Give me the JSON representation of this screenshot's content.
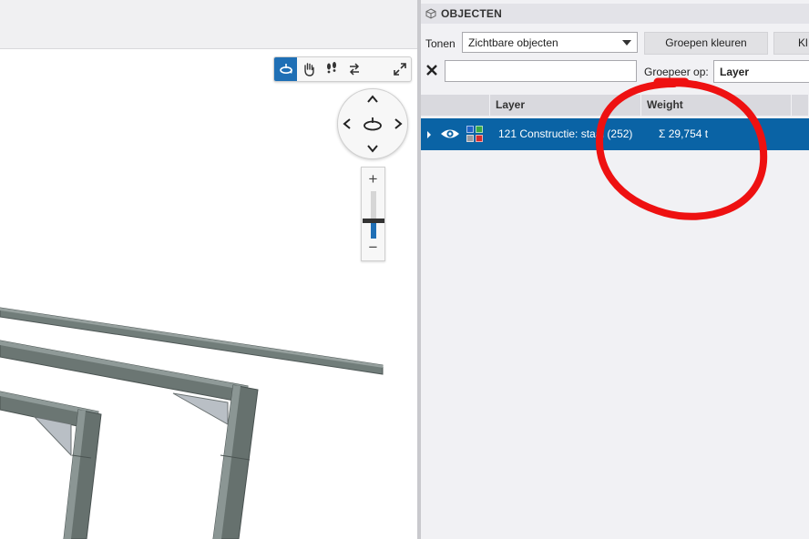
{
  "viewport": {
    "toolbar": {
      "tools": [
        {
          "name": "orbit-icon",
          "active": true
        },
        {
          "name": "pan-hand-icon",
          "active": false
        },
        {
          "name": "walk-footsteps-icon",
          "active": false
        },
        {
          "name": "swap-arrows-icon",
          "active": false
        },
        {
          "name": "fullscreen-icon",
          "active": false
        }
      ]
    },
    "orbit_control": {
      "icons": [
        "arrow-up-icon",
        "arrow-down-icon",
        "arrow-left-icon",
        "arrow-right-icon",
        "orbit-center-icon"
      ]
    },
    "zoom": {
      "plus": "+",
      "minus": "−",
      "level": 0.38
    },
    "model_color": "#6f7b78"
  },
  "panel": {
    "title": "OBJECTEN",
    "show_label": "Tonen",
    "show_select": "Zichtbare objecten",
    "color_groups_button": "Groepen kleuren",
    "cut_button": "Kl",
    "search_value": "",
    "group_by_label": "Groepeer op:",
    "group_by_value": "Layer",
    "columns": [
      "",
      "Layer",
      "Weight",
      ""
    ],
    "rows": [
      {
        "layer": "121 Constructie: staal (252)",
        "weight": "Σ 29,754 t",
        "visible": true,
        "swatch_colors": [
          "#1f63c8",
          "#39a845",
          "#9a9aa0",
          "#d62c2c"
        ]
      }
    ],
    "selection_color": "#0a63a5",
    "annotation_color": "#ee1111"
  }
}
